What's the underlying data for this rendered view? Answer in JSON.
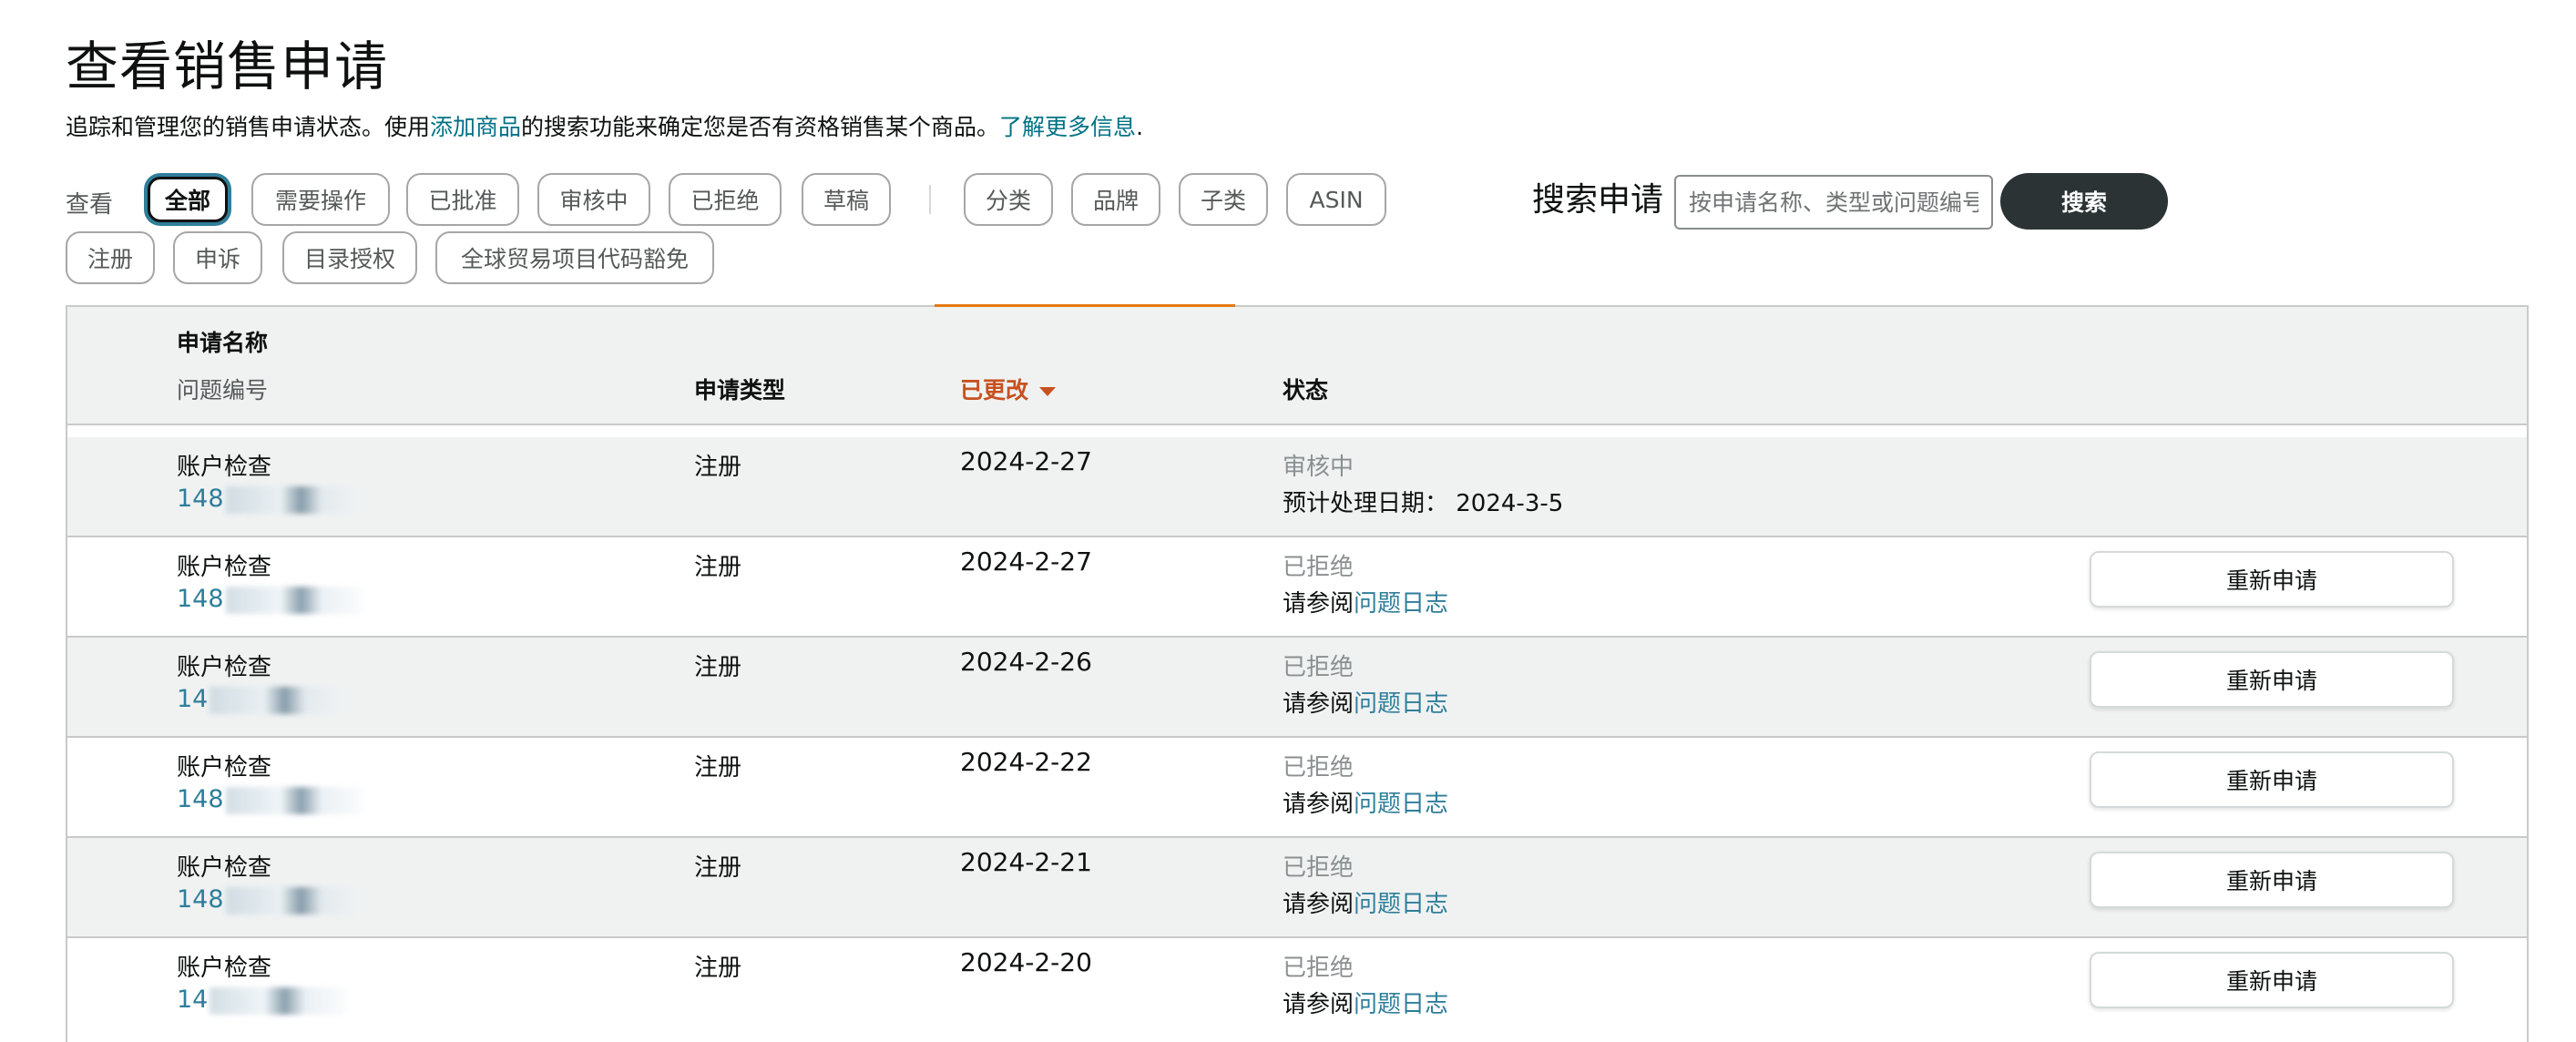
{
  "page": {
    "title": "查看销售申请",
    "subtitle_prefix": "追踪和管理您的销售申请状态。使用",
    "subtitle_link1": "添加商品",
    "subtitle_middle": "的搜索功能来确定您是否有资格销售某个商品。",
    "subtitle_link2": "了解更多信息",
    "subtitle_suffix": "."
  },
  "filters": {
    "view_label": "查看",
    "chips": [
      "全部",
      "需要操作",
      "已批准",
      "审核中",
      "已拒绝",
      "草稿",
      "分类",
      "品牌",
      "子类",
      "ASIN",
      "注册",
      "申诉",
      "目录授权",
      "全球贸易项目代码豁免"
    ],
    "active": "全部"
  },
  "search": {
    "label": "搜索申请",
    "placeholder": "按申请名称、类型或问题编号搜索",
    "button": "搜索"
  },
  "table": {
    "headers": {
      "name": "申请名称",
      "issue": "问题编号",
      "type": "申请类型",
      "modified": "已更改",
      "status": "状态"
    },
    "rows": [
      {
        "name": "账户检查",
        "issue": "148",
        "type": "注册",
        "date": "2024-2-27",
        "status": "审核中",
        "note_prefix": "预计处理日期：  2024-3-5",
        "note_link": "",
        "action": ""
      },
      {
        "name": "账户检查",
        "issue": "148",
        "type": "注册",
        "date": "2024-2-27",
        "status": "已拒绝",
        "note_prefix": "请参阅",
        "note_link": "问题日志",
        "action": "重新申请"
      },
      {
        "name": "账户检查",
        "issue": "14",
        "type": "注册",
        "date": "2024-2-26",
        "status": "已拒绝",
        "note_prefix": "请参阅",
        "note_link": "问题日志",
        "action": "重新申请"
      },
      {
        "name": "账户检查",
        "issue": "148",
        "type": "注册",
        "date": "2024-2-22",
        "status": "已拒绝",
        "note_prefix": "请参阅",
        "note_link": "问题日志",
        "action": "重新申请"
      },
      {
        "name": "账户检查",
        "issue": "148",
        "type": "注册",
        "date": "2024-2-21",
        "status": "已拒绝",
        "note_prefix": "请参阅",
        "note_link": "问题日志",
        "action": "重新申请"
      },
      {
        "name": "账户检查",
        "issue": "14",
        "type": "注册",
        "date": "2024-2-20",
        "status": "已拒绝",
        "note_prefix": "请参阅",
        "note_link": "问题日志",
        "action": "重新申请"
      }
    ]
  },
  "colors": {
    "link": "#007185",
    "sort_accent": "#c7511f",
    "header_bg": "#f0f2f2",
    "search_button_bg": "#2b3334"
  }
}
